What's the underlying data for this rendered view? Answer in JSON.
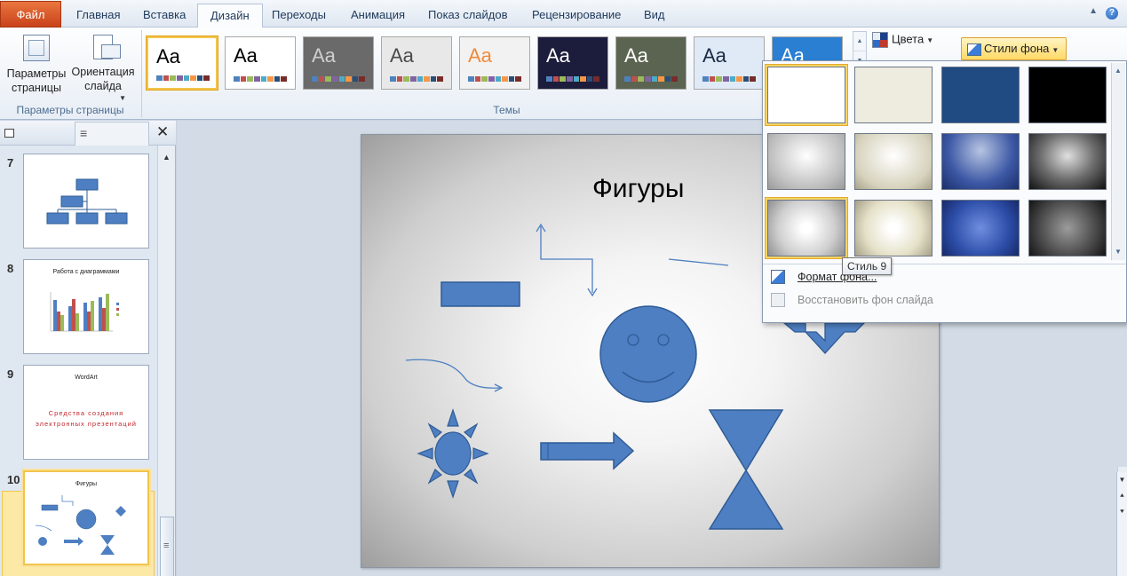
{
  "tabs": [
    "Файл",
    "Главная",
    "Вставка",
    "Дизайн",
    "Переходы",
    "Анимация",
    "Показ слайдов",
    "Рецензирование",
    "Вид"
  ],
  "active_tab": "Дизайн",
  "page_setup": {
    "page_params_label": "Параметры\nстраницы",
    "orientation_label": "Ориентация\nслайда",
    "group_label": "Параметры страницы"
  },
  "themes": {
    "group_label": "Темы",
    "sample_text": "Aa",
    "items": [
      {
        "name": "office",
        "bg": "#ffffff",
        "fg": "#000000",
        "selected": true
      },
      {
        "name": "theme-2",
        "bg": "#ffffff",
        "fg": "#000000",
        "selected": false
      },
      {
        "name": "theme-3",
        "bg": "#6a6a6a",
        "fg": "#cfcfcf",
        "selected": false
      },
      {
        "name": "theme-4",
        "bg": "#e8e8e8",
        "fg": "#4a4a4a",
        "selected": false
      },
      {
        "name": "theme-5",
        "bg": "#f2f2f2",
        "fg": "#f08a3a",
        "selected": false
      },
      {
        "name": "theme-6",
        "bg": "#1c1d3c",
        "fg": "#ffffff",
        "selected": false
      },
      {
        "name": "theme-7",
        "bg": "#5b6450",
        "fg": "#ffffff",
        "selected": false
      },
      {
        "name": "theme-8",
        "bg": "#dfeaf6",
        "fg": "#1a2a44",
        "selected": false
      },
      {
        "name": "theme-9",
        "bg": "#2a7fd3",
        "fg": "#ffffff",
        "selected": false
      }
    ]
  },
  "colors_label": "Цвета",
  "bg_styles_label": "Стили фона",
  "bg_styles": [
    {
      "style": "solid-white",
      "gradient": "#ffffff",
      "selected": true
    },
    {
      "style": "solid-cream",
      "gradient": "#eeebdf",
      "selected": false
    },
    {
      "style": "solid-navy",
      "gradient": "#1f4a82",
      "selected": false
    },
    {
      "style": "solid-black",
      "gradient": "#000000",
      "selected": false
    },
    {
      "style": "grad-silver",
      "gradient": "radial-gradient(ellipse at 50% 40%, #ffffff, #bdbdbd 70%, #9a9a9a)",
      "selected": false
    },
    {
      "style": "grad-cream",
      "gradient": "radial-gradient(ellipse at 50% 40%, #ffffff, #d6d2bc 70%, #aaa38a)",
      "selected": false
    },
    {
      "style": "grad-navy",
      "gradient": "radial-gradient(ellipse at 50% 30%, #b7c5e2, #3d58a5 60%, #1a2f6b)",
      "selected": false
    },
    {
      "style": "grad-black",
      "gradient": "radial-gradient(ellipse at 50% 40%, #e0e0e0, #6e6e6e 50%, #111111)",
      "selected": false
    },
    {
      "style": "radial-silver",
      "gradient": "radial-gradient(circle at 50% 50%, #ffffff 10%, #cfcfcf 60%, #8f8f8f)",
      "selected": true
    },
    {
      "style": "radial-cream",
      "gradient": "radial-gradient(circle at 50% 50%, #ffffff 10%, #e5e1c8 60%, #a6a088)",
      "selected": false
    },
    {
      "style": "radial-navy",
      "gradient": "radial-gradient(circle at 50% 50%, #6f8ee0, #2d4ea8 60%, #17296a)",
      "selected": false
    },
    {
      "style": "radial-black",
      "gradient": "radial-gradient(circle at 50% 50%, #9c9c9c, #4a4a4a 60%, #141414)",
      "selected": false
    }
  ],
  "tooltip": "Стиль 9",
  "menu": {
    "format_bg": "Формат фона...",
    "reset_bg": "Восстановить фон слайда"
  },
  "slides": [
    {
      "num": "7",
      "title": ""
    },
    {
      "num": "8",
      "title": "Работа с диаграммами"
    },
    {
      "num": "9",
      "title": "WordArt",
      "subtitle": "Средства создания электронных презентаций"
    },
    {
      "num": "10",
      "title": "Фигуры",
      "active": true
    }
  ],
  "current_slide": {
    "title": "Фигуры"
  },
  "colors": {
    "shape_fill": "#4e7fc2",
    "shape_stroke": "#2f5c96",
    "accent_select": "#f2c44c"
  }
}
